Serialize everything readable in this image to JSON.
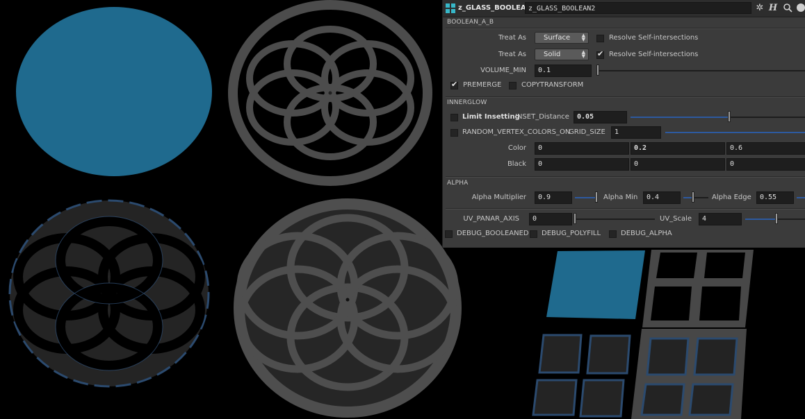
{
  "window": {
    "node_type": "z_GLASS_BOOLEAN",
    "node_name": "z_GLASS_BOOLEAN2",
    "icons": [
      "gear-icon",
      "help-icon",
      "search-icon",
      "info-icon"
    ]
  },
  "boolean_ab": {
    "title": "BOOLEAN_A_B",
    "treat_as_label": "Treat As",
    "treat_as_a": "Surface",
    "treat_as_b": "Solid",
    "resolve_label": "Resolve Self-intersections",
    "resolve_a_checked": false,
    "resolve_b_checked": true,
    "volume_min_label": "VOLUME_MIN",
    "volume_min_value": "0.1",
    "volume_min_level": 0.0,
    "premerge_label": "PREMERGE",
    "premerge_checked": true,
    "copytransform_label": "COPYTRANSFORM",
    "copytransform_checked": false
  },
  "innerglow": {
    "title": "INNERGLOW",
    "limit_insetting_label": "Limit Insetting",
    "inset_distance_label": "INSET_Distance",
    "inset_distance_value": "0.05",
    "random_vertex_colors_label": "RANDOM_VERTEX_COLORS_ON",
    "grid_size_label": "GRID_SIZE",
    "grid_size_value": "1",
    "color_label": "Color",
    "color_values": [
      "0",
      "0.2",
      "0.6"
    ],
    "black_label": "Black",
    "black_values": [
      "0",
      "0",
      "0"
    ]
  },
  "alpha": {
    "title": "ALPHA",
    "multiplier_label": "Alpha Multiplier",
    "multiplier_value": "0.9",
    "min_label": "Alpha Min",
    "min_value": "0.4",
    "edge_label": "Alpha Edge",
    "edge_value": "0.55"
  },
  "uv": {
    "axis_label": "UV_PANAR_AXIS",
    "axis_value": "0",
    "scale_label": "UV_Scale",
    "scale_value": "4"
  },
  "debug": {
    "booleaned_label": "DEBUG_BOOLEANED",
    "polyfill_label": "DEBUG_POLYFILL",
    "alpha_label": "DEBUG_ALPHA"
  },
  "colors": {
    "accent_blue": "#1f6a8e",
    "frame_gray": "#4a4a4a",
    "panel_bg": "#3b3b3b",
    "field_bg": "#1e1e1e"
  }
}
